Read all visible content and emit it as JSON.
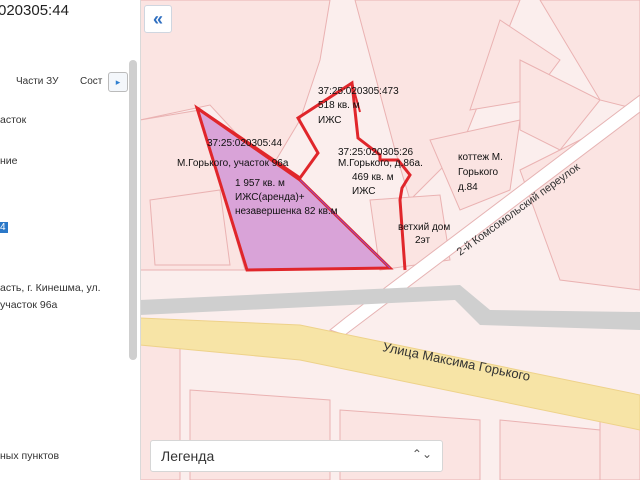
{
  "panel": {
    "title": "020305:44",
    "tabs": [
      "Части ЗУ",
      "Сост"
    ],
    "tab_arrow": "▸",
    "lines": [
      "асток",
      "ние",
      "4",
      "асть, г. Кинешма, ул.",
      "участок 96а",
      "ных пунктов"
    ]
  },
  "map": {
    "collapse_icon": "«",
    "main_parcel": {
      "id": "37:25:020305:44",
      "address": "М.Горького, участок 96а",
      "area": "1 957 кв. м",
      "use": "ИЖС(аренда)+",
      "note": "незавершенка 82 кв.м"
    },
    "parcel_473": {
      "id": "37:25:020305:473",
      "area": "518 кв. м",
      "use": "ИЖС"
    },
    "parcel_26": {
      "id": "37:25:020305:26",
      "address": "М.Горького, д.86а.",
      "area": "469 кв. м",
      "use": "ИЖС"
    },
    "cottage": [
      "коттеж М.",
      "Горького",
      "д.84"
    ],
    "old_house": [
      "ветхий дом",
      "2эт"
    ],
    "street_main": "Улица Максима Горького",
    "street_side": "2-й Комсомольский переулок"
  },
  "legend": {
    "label": "Легенда",
    "icon": "⌃⌄"
  },
  "colors": {
    "parcel_stroke": "#e0262b",
    "parcel_fill": "#d9a3d8",
    "road": "#f5dfa0",
    "lines": "#f0b0b0"
  }
}
